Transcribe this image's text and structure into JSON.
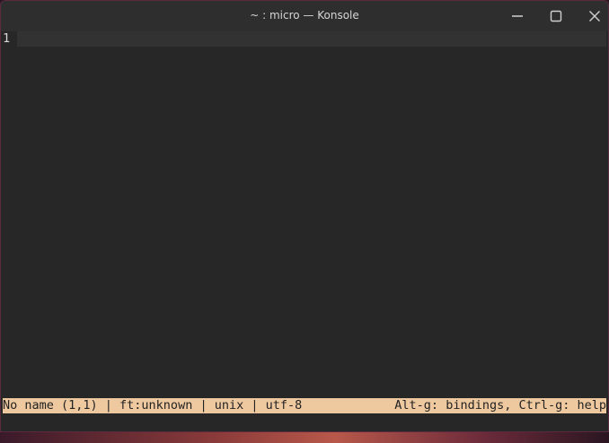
{
  "window": {
    "title": "~ : micro — Konsole"
  },
  "editor": {
    "line_number": "1"
  },
  "status_bar": {
    "left": "No name (1,1) | ft:unknown | unix | utf-8",
    "right": "Alt-g: bindings, Ctrl-g: help"
  },
  "icons": {
    "minimize": "minimize-icon",
    "maximize": "maximize-icon",
    "close": "close-icon"
  },
  "colors": {
    "terminal_bg": "#272727",
    "status_bar_bg": "#eec9a0",
    "titlebar_bg": "#2e2e2e"
  }
}
